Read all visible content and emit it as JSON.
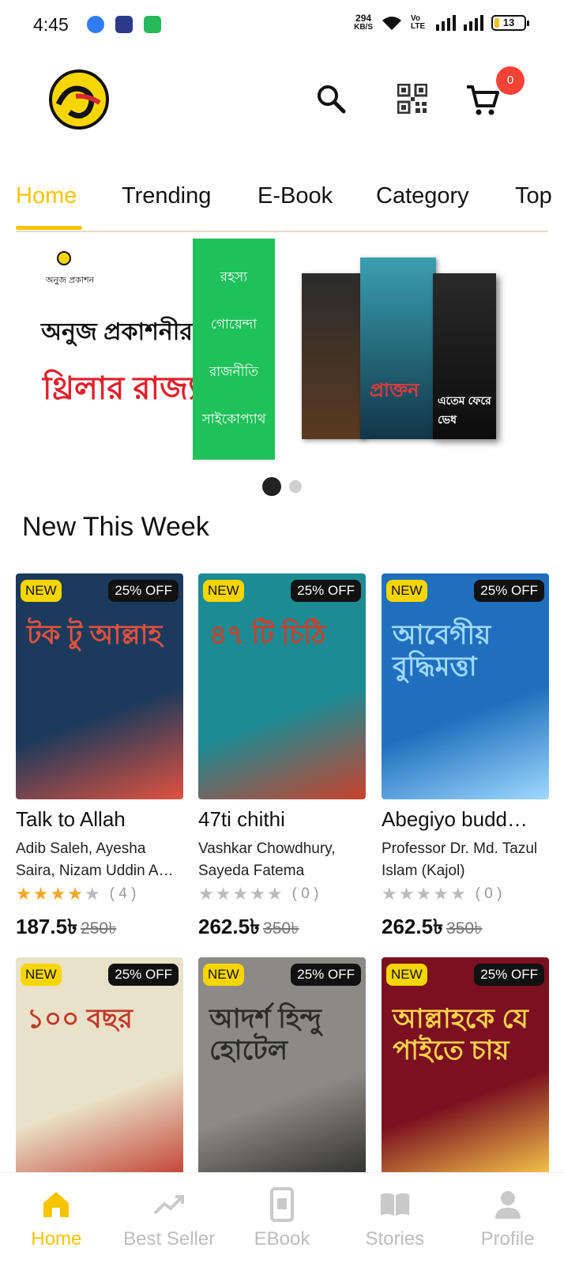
{
  "status": {
    "time": "4:45",
    "net_speed_value": "294",
    "net_speed_unit": "KB/S",
    "volte": "Vo LTE",
    "battery": "13"
  },
  "header": {
    "logo_text": "অ",
    "cart_count": "0"
  },
  "tabs": [
    "Home",
    "Trending",
    "E-Book",
    "Category",
    "Top"
  ],
  "banner": {
    "publisher": "অনুজ প্রকাশন",
    "headline": "অনুজ প্রকাশনীর",
    "subheadline": "থ্রিলার রাজ্য",
    "genres": [
      "রহস্য",
      "গোয়েন্দা",
      "রাজনীতি",
      "সাইকোপ্যাথ"
    ],
    "book_titles": [
      "প্রাক্তন",
      "এতেম ফেরে ভেধ"
    ]
  },
  "section": {
    "title": "New This Week"
  },
  "books": [
    {
      "title": "Talk to Allah",
      "author": "Adib Saleh, Ayesha Saira, Nizam Uddin A…",
      "rating": 4,
      "reviews": "( 4 )",
      "price": "187.5৳",
      "old_price": "250৳",
      "new_label": "NEW",
      "discount": "25% OFF",
      "cover_text": "টক টু আল্লাহ",
      "cover_bg": "#1b3a5c",
      "cover_accent": "#e0523f"
    },
    {
      "title": "47ti chithi",
      "author": "Vashkar Chowdhury, Sayeda Fatema",
      "rating": 0,
      "reviews": "( 0 )",
      "price": "262.5৳",
      "old_price": "350৳",
      "new_label": "NEW",
      "discount": "25% OFF",
      "cover_text": "৪৭ টি চিঠি",
      "cover_bg": "#1c8b94",
      "cover_accent": "#c9412c"
    },
    {
      "title": "Abegiyo budd…",
      "author": "Professor Dr. Md. Tazul Islam (Kajol)",
      "rating": 0,
      "reviews": "( 0 )",
      "price": "262.5৳",
      "old_price": "350৳",
      "new_label": "NEW",
      "discount": "25% OFF",
      "cover_text": "আবেগীয় বুদ্ধিমত্তা",
      "cover_bg": "#1f6fbd",
      "cover_accent": "#9fd9ff"
    },
    {
      "title": "",
      "author": "",
      "rating": 0,
      "reviews": "",
      "price": "",
      "old_price": "",
      "new_label": "NEW",
      "discount": "25% OFF",
      "cover_text": "১০০ বছর",
      "cover_bg": "#e9e1c8",
      "cover_accent": "#c0392b"
    },
    {
      "title": "",
      "author": "",
      "rating": 0,
      "reviews": "",
      "price": "",
      "old_price": "",
      "new_label": "NEW",
      "discount": "25% OFF",
      "cover_text": "আদর্শ হিন্দু হোটেল",
      "cover_bg": "#8c8a86",
      "cover_accent": "#2b2b2b"
    },
    {
      "title": "",
      "author": "",
      "rating": 0,
      "reviews": "",
      "price": "",
      "old_price": "",
      "new_label": "NEW",
      "discount": "25% OFF",
      "cover_text": "আল্লাহকে যে পাইতে চায়",
      "cover_bg": "#7a1020",
      "cover_accent": "#ffd24d"
    }
  ],
  "bottom_nav": [
    {
      "label": "Home",
      "icon": "home-icon"
    },
    {
      "label": "Best Seller",
      "icon": "trending-icon"
    },
    {
      "label": "EBook",
      "icon": "ebook-icon"
    },
    {
      "label": "Stories",
      "icon": "book-open-icon"
    },
    {
      "label": "Profile",
      "icon": "person-icon"
    }
  ]
}
